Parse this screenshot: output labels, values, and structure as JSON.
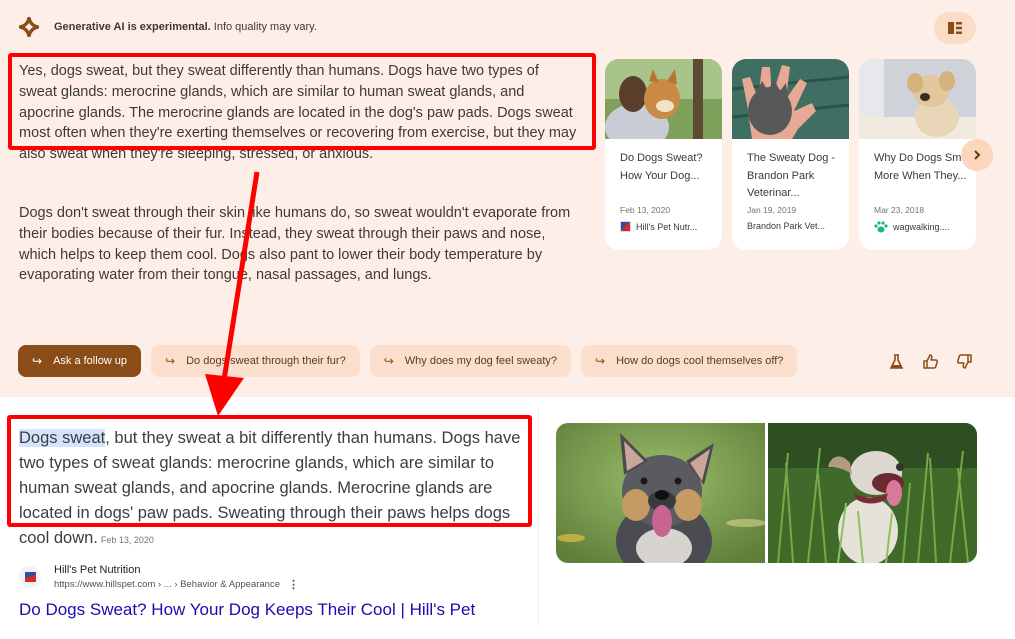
{
  "ai_overview": {
    "header_bold": "Generative AI is experimental.",
    "header_rest": " Info quality may vary.",
    "paragraph1": "Yes, dogs sweat, but they sweat differently than humans. Dogs have two types of sweat glands: merocrine glands, which are similar to human sweat glands, and apocrine glands. The merocrine glands are located in the dog's paw pads. Dogs sweat most often when they're exerting themselves or recovering from exercise, but they may also sweat when they're sleeping, stressed, or anxious.",
    "paragraph2": "Dogs don't sweat through their skin like humans do, so sweat wouldn't evaporate from their bodies because of their fur. Instead, they sweat through their paws and nose, which helps to keep them cool. Dogs also pant to lower their body temperature by evaporating water from their tongue, nasal passages, and lungs.",
    "accent_color": "#8b4d17",
    "background_color": "#fdefe8",
    "sources": [
      {
        "title": "Do Dogs Sweat? How Your Dog...",
        "date": "Feb 13, 2020",
        "source": "Hill's Pet Nutr...",
        "favicon": "hills-logo-icon"
      },
      {
        "title": "The Sweaty Dog - Brandon Park Veterinar...",
        "date": "Jan 19, 2019",
        "source": "Brandon Park Vet...",
        "favicon": ""
      },
      {
        "title": "Why Do Dogs Smell More When They...",
        "date": "Mar 23, 2018",
        "source": "wagwalking....",
        "favicon": "paw-icon"
      }
    ],
    "followups": {
      "primary": "Ask a follow up",
      "suggestions": [
        "Do dogs sweat through their fur?",
        "Why does my dog feel sweaty?",
        "How do dogs cool themselves off?"
      ]
    },
    "icons": [
      "lab-flask-icon",
      "thumbs-up-icon",
      "thumbs-down-icon"
    ]
  },
  "featured_snippet": {
    "highlight": "Dogs sweat",
    "text": ", but they sweat a bit differently than humans. Dogs have two types of sweat glands: merocrine glands, which are similar to human sweat glands, and apocrine glands. Merocrine glands are located in dogs' paw pads. Sweating through their paws helps dogs cool down.",
    "date": "Feb 13, 2020",
    "site_name": "Hill's Pet Nutrition",
    "site_url": "https://www.hillspet.com › ... › Behavior & Appearance",
    "result_title": "Do Dogs Sweat? How Your Dog Keeps Their Cool | Hill's Pet",
    "link_color": "#1a0dab",
    "images": [
      "dog-face-photo",
      "dog-in-grass-photo"
    ]
  }
}
